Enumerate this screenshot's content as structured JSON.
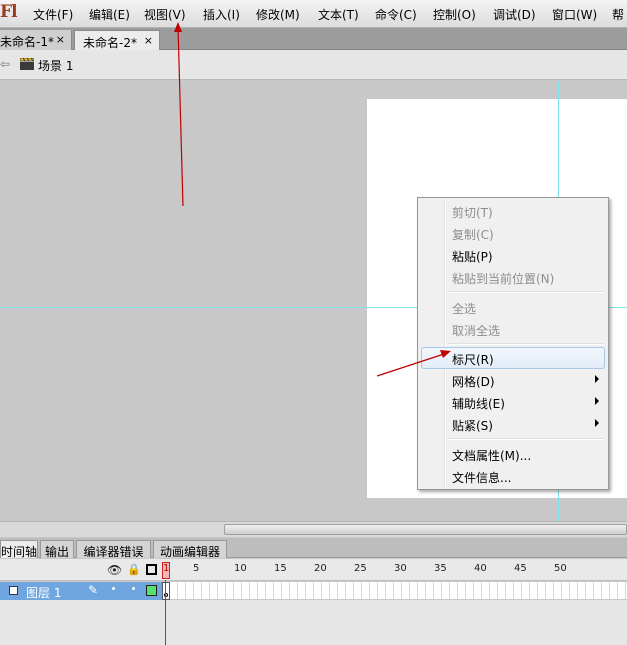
{
  "app": {
    "logo": "Fl"
  },
  "menubar": {
    "items": [
      "文件(F)",
      "编辑(E)",
      "视图(V)",
      "插入(I)",
      "修改(M)",
      "文本(T)",
      "命令(C)",
      "控制(O)",
      "调试(D)",
      "窗口(W)",
      "帮"
    ]
  },
  "tabs": [
    {
      "label": "未命名-1*",
      "close": "×"
    },
    {
      "label": "未命名-2*",
      "close": "×"
    }
  ],
  "editbar": {
    "scene": "场景 1"
  },
  "context_menu": {
    "items": [
      {
        "label": "剪切(T)",
        "state": "disabled"
      },
      {
        "label": "复制(C)",
        "state": "disabled"
      },
      {
        "label": "粘贴(P)",
        "state": "enabled"
      },
      {
        "label": "粘贴到当前位置(N)",
        "state": "disabled"
      },
      {
        "label": "全选",
        "state": "disabled"
      },
      {
        "label": "取消全选",
        "state": "disabled"
      },
      {
        "label": "标尺(R)",
        "state": "hover"
      },
      {
        "label": "网格(D)",
        "state": "enabled",
        "submenu": true
      },
      {
        "label": "辅助线(E)",
        "state": "enabled",
        "submenu": true
      },
      {
        "label": "贴紧(S)",
        "state": "enabled",
        "submenu": true
      },
      {
        "label": "文档属性(M)...",
        "state": "enabled"
      },
      {
        "label": "文件信息...",
        "state": "enabled"
      }
    ]
  },
  "panel": {
    "tabs": [
      "时间轴",
      "输出",
      "编译器错误",
      "动画编辑器"
    ]
  },
  "timeline": {
    "frame_numbers": [
      "5",
      "10",
      "15",
      "20",
      "25",
      "30",
      "35",
      "40",
      "45",
      "50"
    ],
    "current_frame": "1",
    "layer": {
      "name": "图层 1",
      "color": "#55e070"
    }
  },
  "colors": {
    "guide": "#7ee3f0",
    "annotation_arrow": "#c00000",
    "layer_selected": "#6fa6e0",
    "playhead": "#d22222"
  }
}
